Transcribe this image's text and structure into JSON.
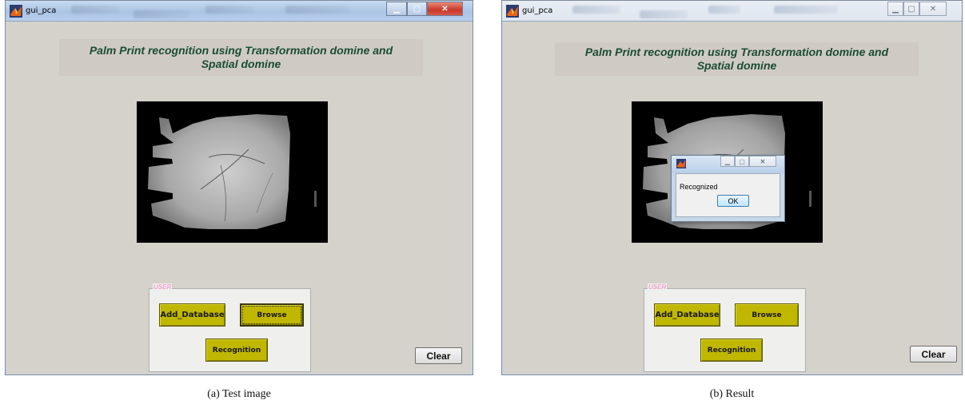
{
  "panels": [
    {
      "window_title": "gui_pca",
      "banner_line1": "Palm Print recognition using Transformation domine and",
      "banner_line2": "Spatial domine",
      "group_label": "USER",
      "buttons": {
        "add_database": "Add_Database",
        "browse": "Browse",
        "recognition": "Recognition",
        "clear": "Clear"
      },
      "caption": "(a) Test image"
    },
    {
      "window_title": "gui_pca",
      "banner_line1": "Palm Print recognition using Transformation domine and",
      "banner_line2": "Spatial domine",
      "group_label": "USER",
      "buttons": {
        "add_database": "Add_Database",
        "browse": "Browse",
        "recognition": "Recognition",
        "clear": "Clear"
      },
      "dialog": {
        "message": "Recognized",
        "ok": "OK"
      },
      "caption": "(b) Result"
    }
  ],
  "colors": {
    "window_bg": "#d5d1cb",
    "banner_text": "#1b4b35",
    "button_bg": "#c0b700",
    "group_label": "#f1a2cc"
  },
  "icons": {
    "app": "matlab-icon",
    "minimize": "minimize-icon",
    "maximize": "maximize-icon",
    "close": "close-icon"
  }
}
